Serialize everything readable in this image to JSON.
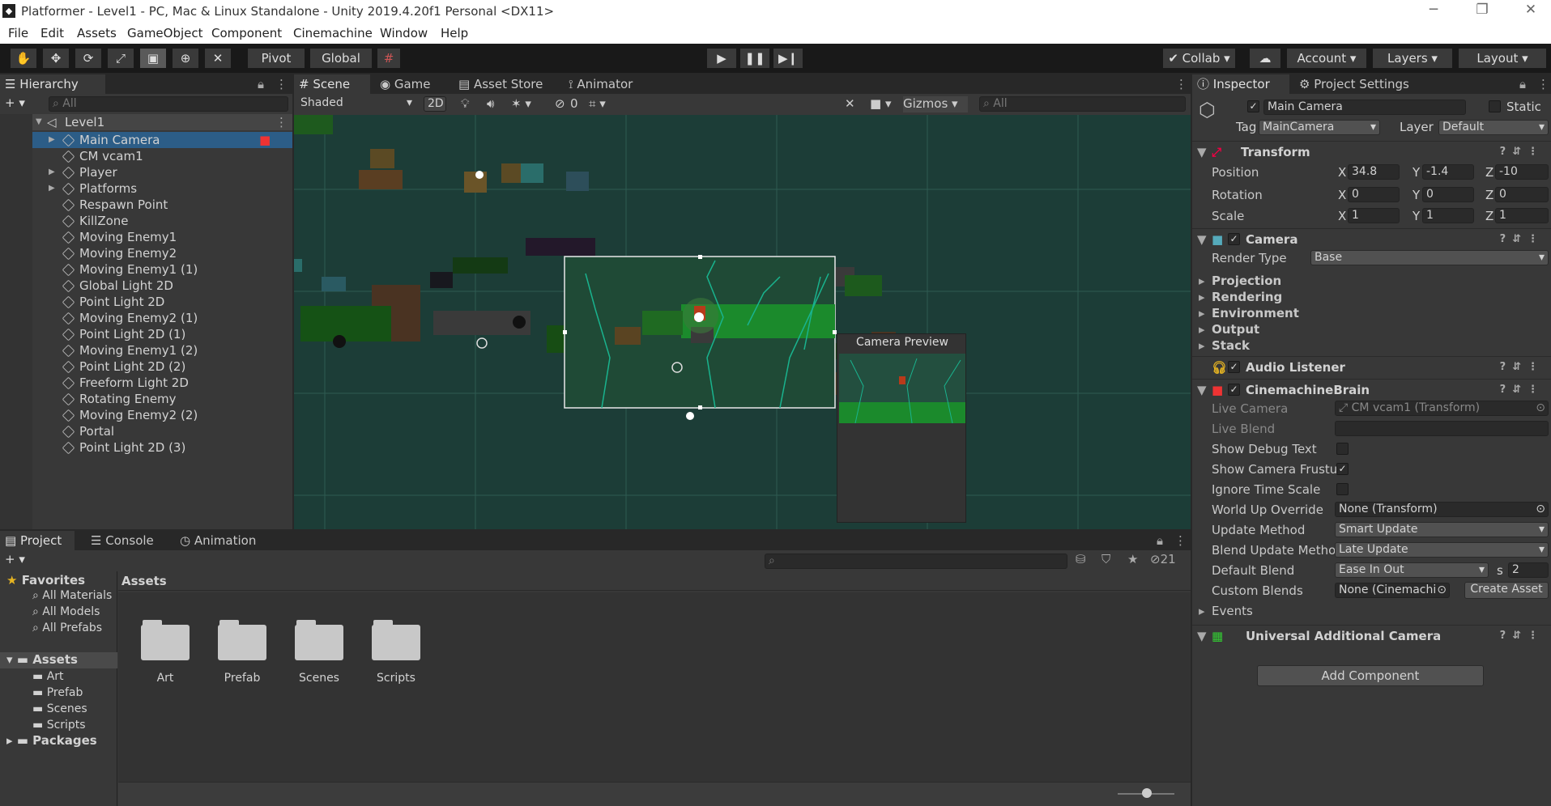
{
  "window": {
    "title": "Platformer - Level1 - PC, Mac & Linux Standalone - Unity 2019.4.20f1 Personal <DX11>",
    "logo": "unity-logo"
  },
  "menu": [
    "File",
    "Edit",
    "Assets",
    "GameObject",
    "Component",
    "Cinemachine",
    "Window",
    "Help"
  ],
  "toolbar": {
    "pivot": "Pivot",
    "global": "Global",
    "collab": "Collab",
    "account": "Account",
    "layers": "Layers",
    "layout": "Layout"
  },
  "hierarchy": {
    "tab": "Hierarchy",
    "search_placeholder": "All",
    "scene": "Level1",
    "items": [
      "Main Camera",
      "CM vcam1",
      "Player",
      "Platforms",
      "Respawn Point",
      "KillZone",
      "Moving Enemy1",
      "Moving Enemy2",
      "Moving Enemy1 (1)",
      "Global Light 2D",
      "Point Light 2D",
      "Moving Enemy2 (1)",
      "Point Light 2D (1)",
      "Moving Enemy1 (2)",
      "Point Light 2D (2)",
      "Freeform Light 2D",
      "Rotating Enemy",
      "Moving Enemy2 (2)",
      "Portal",
      "Point Light 2D (3)"
    ],
    "selected": "Main Camera"
  },
  "scene_view": {
    "tabs": [
      "Scene",
      "Game",
      "Asset Store",
      "Animator"
    ],
    "shading": "Shaded",
    "mode_2d": "2D",
    "hidden_count": "0",
    "gizmos": "Gizmos",
    "search_placeholder": "All",
    "camera_preview_title": "Camera Preview"
  },
  "project": {
    "tabs": [
      "Project",
      "Console",
      "Animation"
    ],
    "favorites_label": "Favorites",
    "favorites": [
      "All Materials",
      "All Models",
      "All Prefabs"
    ],
    "assets_label": "Assets",
    "asset_folders": [
      "Art",
      "Prefab",
      "Scenes",
      "Scripts"
    ],
    "packages_label": "Packages",
    "breadcrumb": "Assets",
    "folders": [
      "Art",
      "Prefab",
      "Scenes",
      "Scripts"
    ],
    "hidden_count": "21"
  },
  "inspector": {
    "tabs": [
      "Inspector",
      "Project Settings"
    ],
    "object_name": "Main Camera",
    "static_label": "Static",
    "tag_label": "Tag",
    "tag": "MainCamera",
    "layer_label": "Layer",
    "layer": "Default",
    "transform": {
      "title": "Transform",
      "position_label": "Position",
      "pos": {
        "x": "34.8",
        "y": "-1.4",
        "z": "-10"
      },
      "rotation_label": "Rotation",
      "rot": {
        "x": "0",
        "y": "0",
        "z": "0"
      },
      "scale_label": "Scale",
      "scale": {
        "x": "1",
        "y": "1",
        "z": "1"
      }
    },
    "camera": {
      "title": "Camera",
      "render_type_label": "Render Type",
      "render_type": "Base",
      "sections": [
        "Projection",
        "Rendering",
        "Environment",
        "Output",
        "Stack"
      ]
    },
    "audio_listener": {
      "title": "Audio Listener"
    },
    "brain": {
      "title": "CinemachineBrain",
      "live_camera_label": "Live Camera",
      "live_camera": "CM vcam1 (Transform)",
      "live_blend_label": "Live Blend",
      "show_debug_label": "Show Debug Text",
      "show_frustum_label": "Show Camera Frustu",
      "ignore_time_label": "Ignore Time Scale",
      "world_up_label": "World Up Override",
      "world_up": "None (Transform)",
      "update_method_label": "Update Method",
      "update_method": "Smart Update",
      "blend_update_label": "Blend Update Methoc",
      "blend_update": "Late Update",
      "default_blend_label": "Default Blend",
      "default_blend": "Ease In Out",
      "s_label": "s",
      "blend_time": "2",
      "custom_blends_label": "Custom Blends",
      "custom_blends": "None (Cinemachi",
      "create_asset": "Create Asset",
      "events_label": "Events"
    },
    "urp_data": {
      "title": "Universal Additional Camera Data (Scri"
    },
    "add_component": "Add Component"
  }
}
